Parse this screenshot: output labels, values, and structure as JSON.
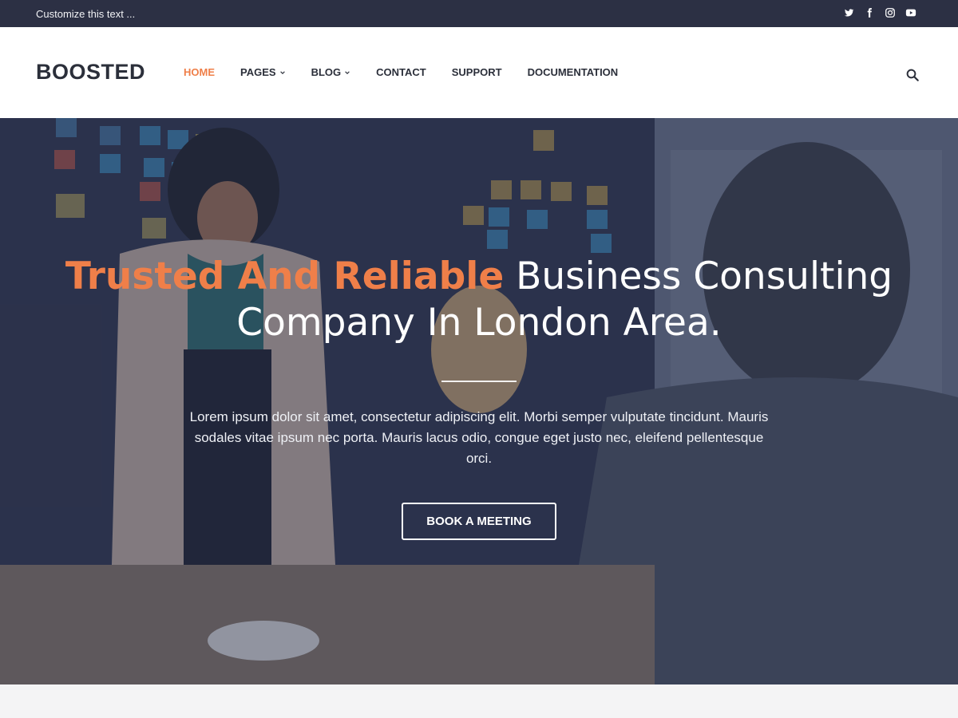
{
  "topbar": {
    "text": "Customize this text ...",
    "social": [
      "twitter-icon",
      "facebook-icon",
      "instagram-icon",
      "youtube-icon"
    ]
  },
  "header": {
    "logo": "BOOSTED",
    "nav": [
      {
        "label": "HOME",
        "active": true,
        "dropdown": false
      },
      {
        "label": "PAGES",
        "active": false,
        "dropdown": true
      },
      {
        "label": "BLOG",
        "active": false,
        "dropdown": true
      },
      {
        "label": "CONTACT",
        "active": false,
        "dropdown": false
      },
      {
        "label": "SUPPORT",
        "active": false,
        "dropdown": false
      },
      {
        "label": "DOCUMENTATION",
        "active": false,
        "dropdown": false
      }
    ],
    "search_icon": "search-icon"
  },
  "hero": {
    "title_accent": "Trusted And Reliable",
    "title_rest": " Business Consulting Company In London Area.",
    "description": "Lorem ipsum dolor sit amet, consectetur adipiscing elit. Morbi semper vulputate tincidunt. Mauris sodales vitae ipsum nec porta. Mauris lacus odio, congue eget justo nec, eleifend pellentesque orci.",
    "cta_label": "BOOK A MEETING"
  },
  "colors": {
    "topbar": "#2c3044",
    "accent": "#ef7f49",
    "text_dark": "#2b2f3a"
  }
}
